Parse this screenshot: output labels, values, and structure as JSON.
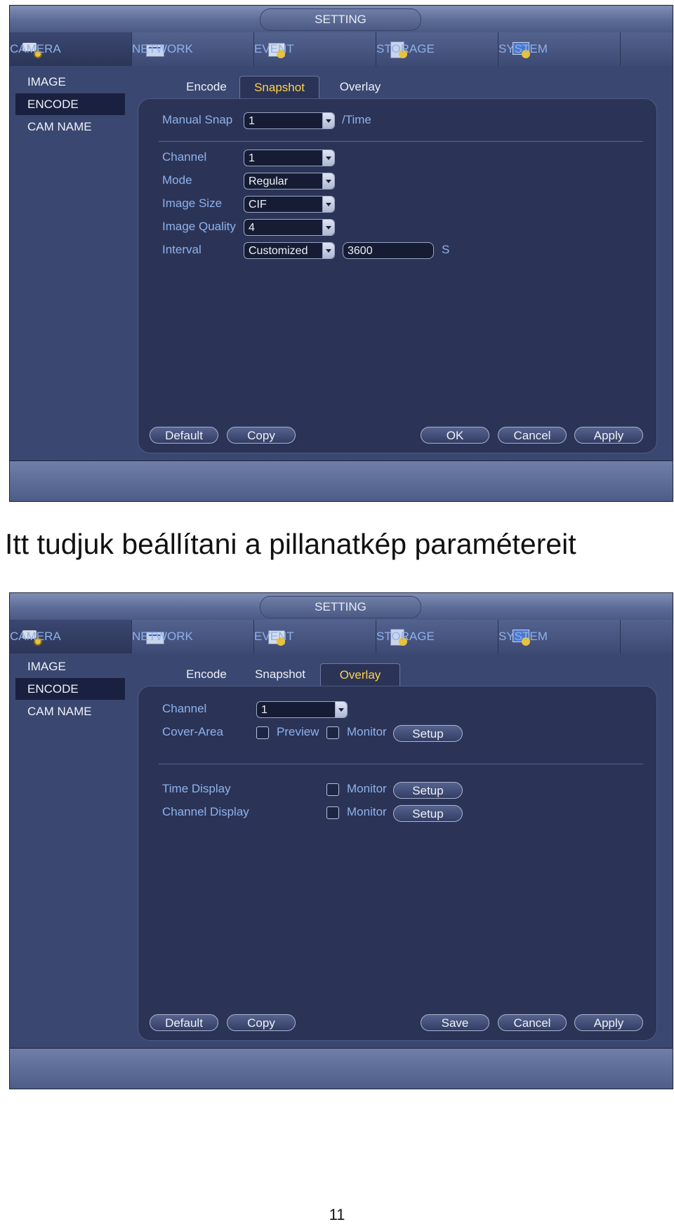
{
  "window_title": "SETTING",
  "main_tabs": [
    {
      "label": "CAMERA",
      "icon": "camera-gear-icon"
    },
    {
      "label": "NETWORK",
      "icon": "network-icon"
    },
    {
      "label": "EVENT",
      "icon": "event-icon"
    },
    {
      "label": "STORAGE",
      "icon": "storage-icon"
    },
    {
      "label": "SYSTEM",
      "icon": "system-icon"
    }
  ],
  "sidebar": {
    "items": [
      "IMAGE",
      "ENCODE",
      "CAM NAME"
    ],
    "active": "ENCODE"
  },
  "sub_tabs": [
    "Encode",
    "Snapshot",
    "Overlay"
  ],
  "snapshot": {
    "manual_snap": {
      "label": "Manual Snap",
      "value": "1",
      "unit": "/Time"
    },
    "channel": {
      "label": "Channel",
      "value": "1"
    },
    "mode": {
      "label": "Mode",
      "value": "Regular"
    },
    "image_size": {
      "label": "Image Size",
      "value": "CIF"
    },
    "image_quality": {
      "label": "Image Quality",
      "value": "4"
    },
    "interval": {
      "label": "Interval",
      "value": "Customized",
      "seconds": "3600",
      "unit": "S"
    },
    "buttons": {
      "default": "Default",
      "copy": "Copy",
      "ok": "OK",
      "cancel": "Cancel",
      "apply": "Apply"
    }
  },
  "caption": "Itt tudjuk beállítani a pillanatkép paramétereit",
  "overlay": {
    "channel": {
      "label": "Channel",
      "value": "1"
    },
    "cover_area": {
      "label": "Cover-Area",
      "preview": "Preview",
      "monitor": "Monitor",
      "setup": "Setup"
    },
    "time_display": {
      "label": "Time Display",
      "monitor": "Monitor",
      "setup": "Setup"
    },
    "channel_display": {
      "label": "Channel Display",
      "monitor": "Monitor",
      "setup": "Setup"
    },
    "buttons": {
      "default": "Default",
      "copy": "Copy",
      "save": "Save",
      "cancel": "Cancel",
      "apply": "Apply"
    }
  },
  "page_number": "11",
  "colors": {
    "active_tab": "#ffd24a",
    "label": "#8fb1ea",
    "background": "#2e3858"
  }
}
